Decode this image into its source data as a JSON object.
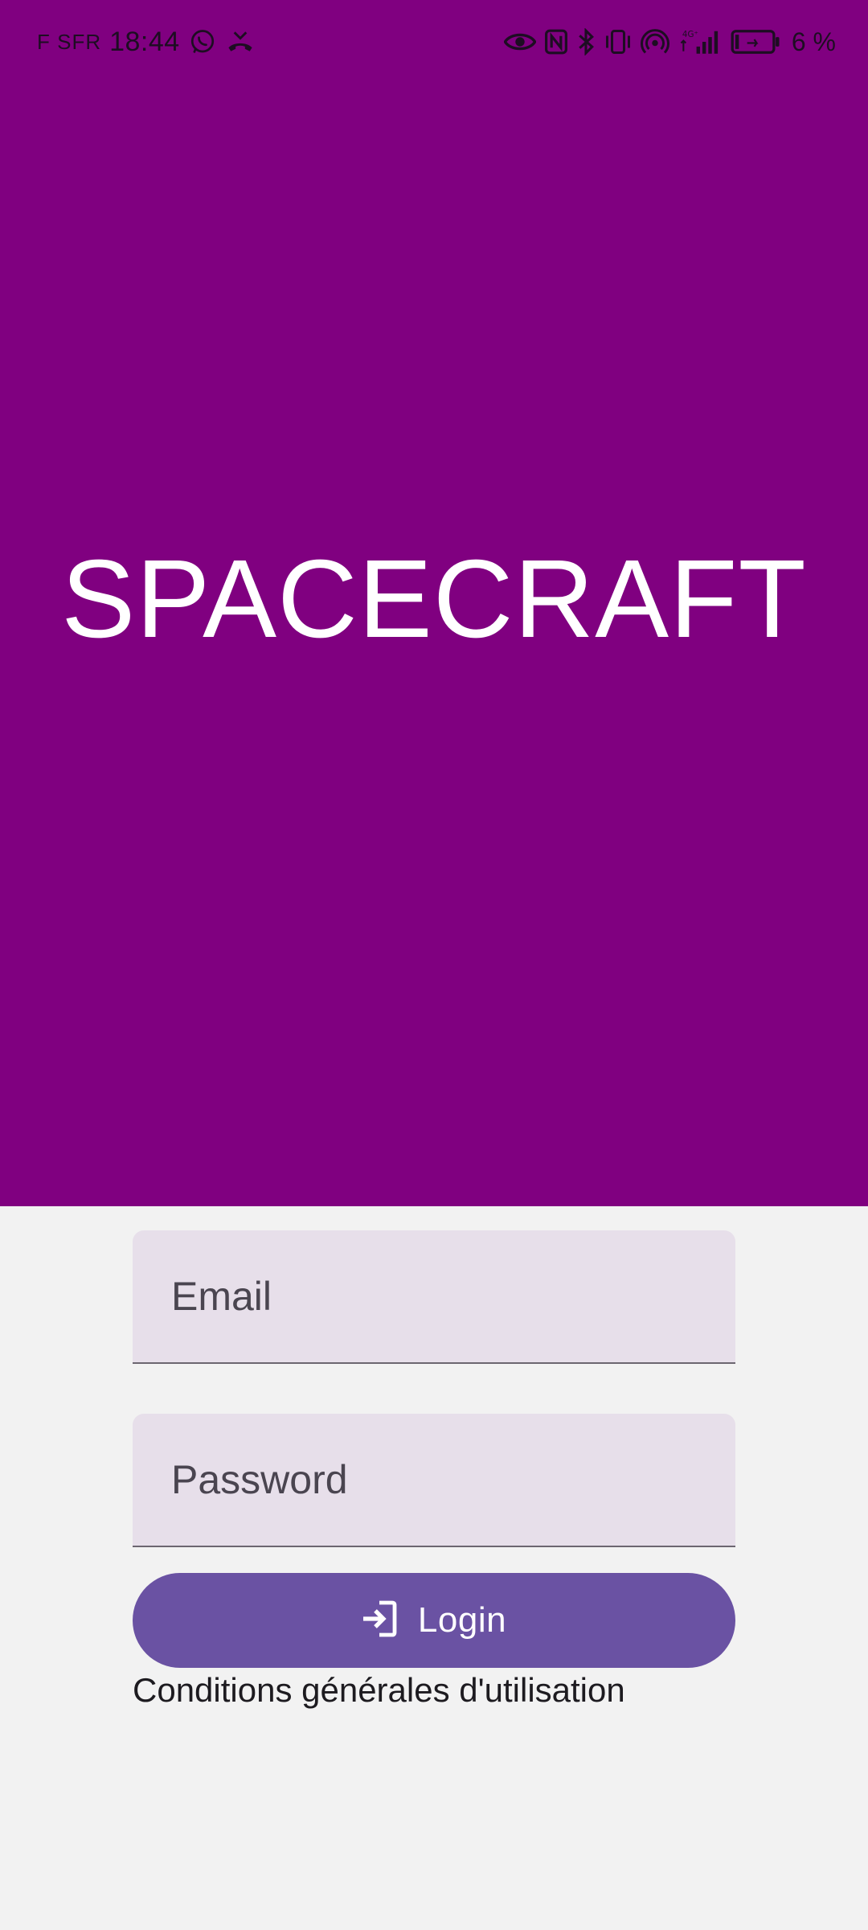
{
  "status_bar": {
    "carrier": "F SFR",
    "time": "18:44",
    "battery": "6 %",
    "icons_left": [
      "whatsapp-icon",
      "missed-call-icon"
    ],
    "icons_right": [
      "eye-icon",
      "nfc-icon",
      "bluetooth-icon",
      "vibrate-icon",
      "hotspot-icon",
      "signal-4g-icon",
      "battery-icon"
    ]
  },
  "hero": {
    "title": "SPACECRAFT",
    "background": "#800080"
  },
  "form": {
    "email_placeholder": "Email",
    "email_value": "",
    "password_placeholder": "Password",
    "password_value": "",
    "login_label": "Login",
    "login_icon": "login-icon",
    "terms_label": "Conditions générales d'utilisation",
    "accent": "#6a52a3"
  }
}
